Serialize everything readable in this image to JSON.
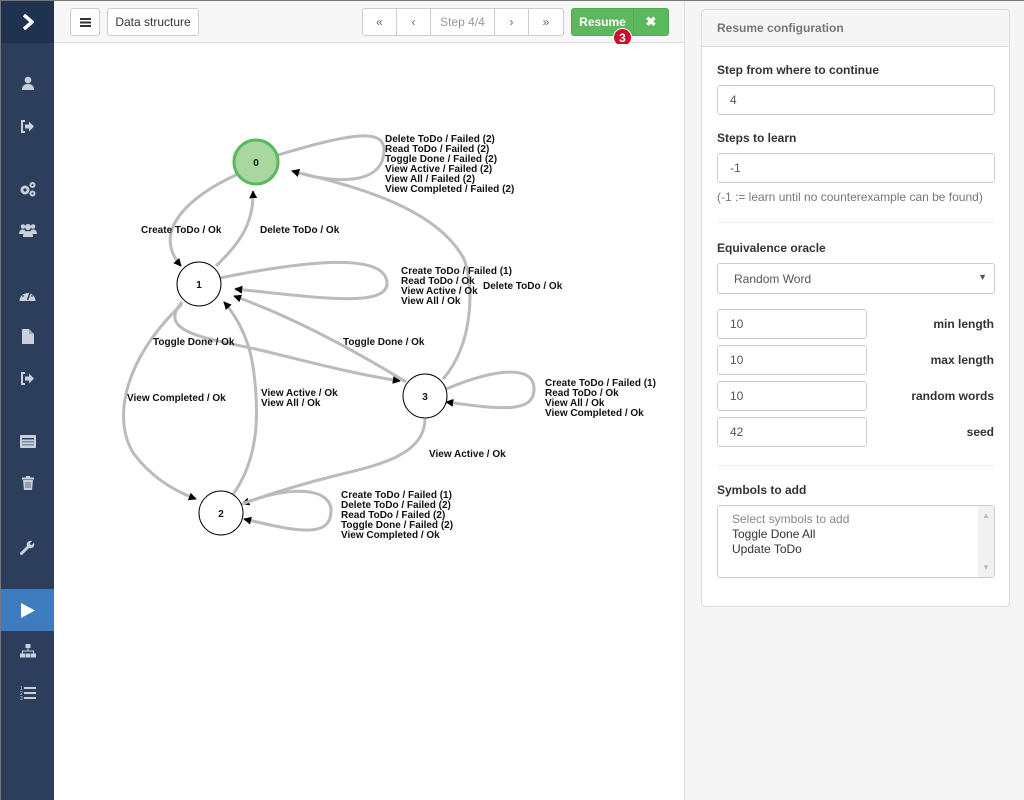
{
  "sidebar": {
    "toggle_icon": "chevron-right-icon",
    "items": [
      {
        "icon": "user-icon"
      },
      {
        "icon": "sign-out-icon"
      },
      {
        "icon": "cogs-icon"
      },
      {
        "icon": "users-icon"
      },
      {
        "icon": "dashboard-icon"
      },
      {
        "icon": "file-icon"
      },
      {
        "icon": "sign-out-icon"
      },
      {
        "icon": "list-alt-icon"
      },
      {
        "icon": "trash-icon"
      },
      {
        "icon": "wrench-icon"
      },
      {
        "icon": "play-icon",
        "active": true
      },
      {
        "icon": "sitemap-icon"
      },
      {
        "icon": "list-ol-icon"
      }
    ]
  },
  "toolbar": {
    "menu_icon": "bars-icon",
    "data_structure_label": "Data structure",
    "first_label": "«",
    "prev_label": "‹",
    "step_label": "Step 4/4",
    "next_label": "›",
    "last_label": "»",
    "resume_label": "Resume",
    "close_label": "✖",
    "badge": "3",
    "accent": "#5cb85c"
  },
  "graph": {
    "initial_state_color": "#a8d8a0",
    "nodes": [
      {
        "id": "0",
        "label": "0",
        "initial": true
      },
      {
        "id": "1",
        "label": "1"
      },
      {
        "id": "2",
        "label": "2"
      },
      {
        "id": "3",
        "label": "3"
      }
    ],
    "edges": [
      {
        "from": "0",
        "to": "0",
        "labels": [
          "Delete ToDo / Failed (2)",
          "Read ToDo / Failed (2)",
          "Toggle Done / Failed (2)",
          "View Active / Failed (2)",
          "View All / Failed (2)",
          "View Completed / Failed (2)"
        ]
      },
      {
        "from": "0",
        "to": "1",
        "labels": [
          "Create ToDo / Ok"
        ]
      },
      {
        "from": "1",
        "to": "0",
        "labels": [
          "Delete ToDo / Ok"
        ]
      },
      {
        "from": "1",
        "to": "1",
        "labels": [
          "Create ToDo / Failed (1)",
          "Read ToDo / Ok",
          "View Active / Ok",
          "View All / Ok"
        ]
      },
      {
        "from": "3",
        "to": "0",
        "labels": [
          "Delete ToDo / Ok"
        ]
      },
      {
        "from": "1",
        "to": "3",
        "labels": [
          "Toggle Done / Ok"
        ]
      },
      {
        "from": "3",
        "to": "1",
        "labels": [
          "Toggle Done / Ok"
        ]
      },
      {
        "from": "1",
        "to": "2",
        "labels": [
          "View Completed / Ok"
        ]
      },
      {
        "from": "2",
        "to": "1",
        "labels": [
          "View Active / Ok",
          "View All / Ok"
        ]
      },
      {
        "from": "3",
        "to": "3",
        "labels": [
          "Create ToDo / Failed (1)",
          "Read ToDo / Ok",
          "View All / Ok",
          "View Completed / Ok"
        ]
      },
      {
        "from": "3",
        "to": "2",
        "labels": [
          "View Active / Ok"
        ]
      },
      {
        "from": "2",
        "to": "2",
        "labels": [
          "Create ToDo / Failed (1)",
          "Delete ToDo / Failed (2)",
          "Read ToDo / Failed (2)",
          "Toggle Done / Failed (2)",
          "View Completed / Ok"
        ]
      }
    ]
  },
  "config": {
    "title": "Resume configuration",
    "step_label": "Step from where to continue",
    "step_value": "4",
    "steps_to_learn_label": "Steps to learn",
    "steps_to_learn_value": "-1",
    "steps_help": "(-1 := learn until no counterexample can be found)",
    "oracle_label": "Equivalence oracle",
    "oracle_value": "Random Word",
    "min_length_label": "min length",
    "min_length_value": "10",
    "max_length_label": "max length",
    "max_length_value": "10",
    "random_words_label": "random words",
    "random_words_value": "10",
    "seed_label": "seed",
    "seed_value": "42",
    "symbols_label": "Symbols to add",
    "symbols_placeholder": "Select symbols to add",
    "symbols_options": [
      "Toggle Done All",
      "Update ToDo"
    ]
  }
}
